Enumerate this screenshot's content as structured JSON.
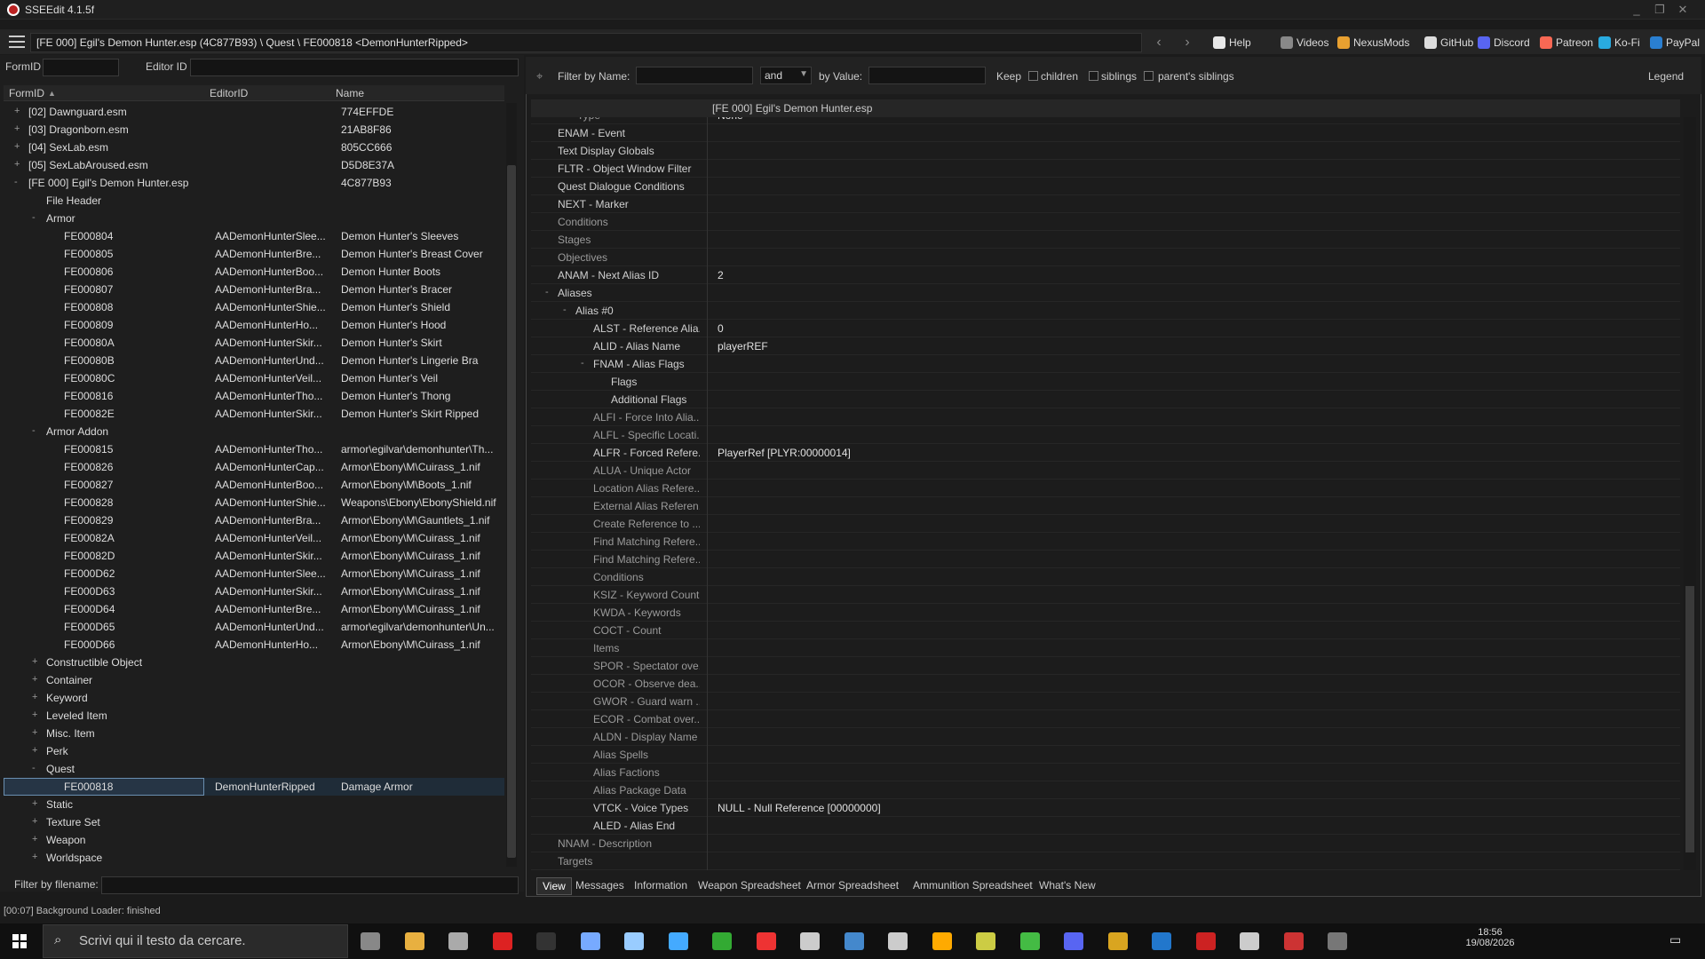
{
  "window": {
    "title": "SSEEdit 4.1.5f"
  },
  "path": "[FE 000] Egil's Demon Hunter.esp (4C877B93) \\ Quest \\ FE000818 <DemonHunterRipped>",
  "toplinks": [
    {
      "label": "Help",
      "icon": "book-icon",
      "color": "#e8e8e8"
    },
    {
      "label": "Videos",
      "icon": "videos-icon",
      "color": "#888888"
    },
    {
      "label": "NexusMods",
      "icon": "nexusmods-icon",
      "color": "#e8a030"
    },
    {
      "label": "GitHub",
      "icon": "github-icon",
      "color": "#dddddd"
    },
    {
      "label": "Discord",
      "icon": "discord-icon",
      "color": "#5865f2"
    },
    {
      "label": "Patreon",
      "icon": "patreon-icon",
      "color": "#f96854"
    },
    {
      "label": "Ko-Fi",
      "icon": "kofi-icon",
      "color": "#29abe0"
    },
    {
      "label": "PayPal",
      "icon": "paypal-icon",
      "color": "#2a7fd0"
    }
  ],
  "left": {
    "formid_label": "FormID",
    "editorid_label": "Editor ID",
    "columns": [
      "FormID",
      "EditorID",
      "Name"
    ],
    "filter_label": "Filter by filename:",
    "rows": [
      {
        "indent": 1,
        "exp": "+",
        "c1": "[02] Dawnguard.esm",
        "c2": "",
        "c3": "774EFFDE"
      },
      {
        "indent": 1,
        "exp": "+",
        "c1": "[03] Dragonborn.esm",
        "c2": "",
        "c3": "21AB8F86"
      },
      {
        "indent": 1,
        "exp": "+",
        "c1": "[04] SexLab.esm",
        "c2": "",
        "c3": "805CC666"
      },
      {
        "indent": 1,
        "exp": "+",
        "c1": "[05] SexLabAroused.esm",
        "c2": "",
        "c3": "D5D8E37A"
      },
      {
        "indent": 1,
        "exp": "-",
        "c1": "[FE 000] Egil's Demon Hunter.esp",
        "c2": "",
        "c3": "4C877B93"
      },
      {
        "indent": 2,
        "exp": "",
        "c1": "File Header",
        "c2": "",
        "c3": ""
      },
      {
        "indent": 2,
        "exp": "-",
        "c1": "Armor",
        "c2": "",
        "c3": ""
      },
      {
        "indent": 3,
        "exp": "",
        "c1": "FE000804",
        "c2": "AADemonHunterSlee...",
        "c3": "Demon Hunter's Sleeves"
      },
      {
        "indent": 3,
        "exp": "",
        "c1": "FE000805",
        "c2": "AADemonHunterBre...",
        "c3": "Demon Hunter's Breast Cover"
      },
      {
        "indent": 3,
        "exp": "",
        "c1": "FE000806",
        "c2": "AADemonHunterBoo...",
        "c3": "Demon Hunter Boots"
      },
      {
        "indent": 3,
        "exp": "",
        "c1": "FE000807",
        "c2": "AADemonHunterBra...",
        "c3": "Demon Hunter's Bracer"
      },
      {
        "indent": 3,
        "exp": "",
        "c1": "FE000808",
        "c2": "AADemonHunterShie...",
        "c3": "Demon Hunter's Shield"
      },
      {
        "indent": 3,
        "exp": "",
        "c1": "FE000809",
        "c2": "AADemonHunterHo...",
        "c3": "Demon Hunter's Hood"
      },
      {
        "indent": 3,
        "exp": "",
        "c1": "FE00080A",
        "c2": "AADemonHunterSkir...",
        "c3": "Demon Hunter's Skirt"
      },
      {
        "indent": 3,
        "exp": "",
        "c1": "FE00080B",
        "c2": "AADemonHunterUnd...",
        "c3": "Demon Hunter's Lingerie Bra"
      },
      {
        "indent": 3,
        "exp": "",
        "c1": "FE00080C",
        "c2": "AADemonHunterVeil...",
        "c3": "Demon Hunter's Veil"
      },
      {
        "indent": 3,
        "exp": "",
        "c1": "FE000816",
        "c2": "AADemonHunterTho...",
        "c3": "Demon Hunter's Thong"
      },
      {
        "indent": 3,
        "exp": "",
        "c1": "FE00082E",
        "c2": "AADemonHunterSkir...",
        "c3": "Demon Hunter's Skirt Ripped"
      },
      {
        "indent": 2,
        "exp": "-",
        "c1": "Armor Addon",
        "c2": "",
        "c3": ""
      },
      {
        "indent": 3,
        "exp": "",
        "c1": "FE000815",
        "c2": "AADemonHunterTho...",
        "c3": "armor\\egilvar\\demonhunter\\Th..."
      },
      {
        "indent": 3,
        "exp": "",
        "c1": "FE000826",
        "c2": "AADemonHunterCap...",
        "c3": "Armor\\Ebony\\M\\Cuirass_1.nif"
      },
      {
        "indent": 3,
        "exp": "",
        "c1": "FE000827",
        "c2": "AADemonHunterBoo...",
        "c3": "Armor\\Ebony\\M\\Boots_1.nif"
      },
      {
        "indent": 3,
        "exp": "",
        "c1": "FE000828",
        "c2": "AADemonHunterShie...",
        "c3": "Weapons\\Ebony\\EbonyShield.nif"
      },
      {
        "indent": 3,
        "exp": "",
        "c1": "FE000829",
        "c2": "AADemonHunterBra...",
        "c3": "Armor\\Ebony\\M\\Gauntlets_1.nif"
      },
      {
        "indent": 3,
        "exp": "",
        "c1": "FE00082A",
        "c2": "AADemonHunterVeil...",
        "c3": "Armor\\Ebony\\M\\Cuirass_1.nif"
      },
      {
        "indent": 3,
        "exp": "",
        "c1": "FE00082D",
        "c2": "AADemonHunterSkir...",
        "c3": "Armor\\Ebony\\M\\Cuirass_1.nif"
      },
      {
        "indent": 3,
        "exp": "",
        "c1": "FE000D62",
        "c2": "AADemonHunterSlee...",
        "c3": "Armor\\Ebony\\M\\Cuirass_1.nif"
      },
      {
        "indent": 3,
        "exp": "",
        "c1": "FE000D63",
        "c2": "AADemonHunterSkir...",
        "c3": "Armor\\Ebony\\M\\Cuirass_1.nif"
      },
      {
        "indent": 3,
        "exp": "",
        "c1": "FE000D64",
        "c2": "AADemonHunterBre...",
        "c3": "Armor\\Ebony\\M\\Cuirass_1.nif"
      },
      {
        "indent": 3,
        "exp": "",
        "c1": "FE000D65",
        "c2": "AADemonHunterUnd...",
        "c3": "armor\\egilvar\\demonhunter\\Un..."
      },
      {
        "indent": 3,
        "exp": "",
        "c1": "FE000D66",
        "c2": "AADemonHunterHo...",
        "c3": "Armor\\Ebony\\M\\Cuirass_1.nif"
      },
      {
        "indent": 2,
        "exp": "+",
        "c1": "Constructible Object",
        "c2": "",
        "c3": ""
      },
      {
        "indent": 2,
        "exp": "+",
        "c1": "Container",
        "c2": "",
        "c3": ""
      },
      {
        "indent": 2,
        "exp": "+",
        "c1": "Keyword",
        "c2": "",
        "c3": ""
      },
      {
        "indent": 2,
        "exp": "+",
        "c1": "Leveled Item",
        "c2": "",
        "c3": ""
      },
      {
        "indent": 2,
        "exp": "+",
        "c1": "Misc. Item",
        "c2": "",
        "c3": ""
      },
      {
        "indent": 2,
        "exp": "+",
        "c1": "Perk",
        "c2": "",
        "c3": ""
      },
      {
        "indent": 2,
        "exp": "-",
        "c1": "Quest",
        "c2": "",
        "c3": ""
      },
      {
        "indent": 3,
        "exp": "",
        "c1": "FE000818",
        "c2": "DemonHunterRipped",
        "c3": "Damage Armor",
        "selected": true
      },
      {
        "indent": 2,
        "exp": "+",
        "c1": "Static",
        "c2": "",
        "c3": ""
      },
      {
        "indent": 2,
        "exp": "+",
        "c1": "Texture Set",
        "c2": "",
        "c3": ""
      },
      {
        "indent": 2,
        "exp": "+",
        "c1": "Weapon",
        "c2": "",
        "c3": ""
      },
      {
        "indent": 2,
        "exp": "+",
        "c1": "Worldspace",
        "c2": "",
        "c3": ""
      }
    ]
  },
  "right": {
    "filter_name_label": "Filter by Name:",
    "and_value": "and",
    "by_value_label": "by Value:",
    "keep_label": "Keep",
    "children_label": "children",
    "siblings_label": "siblings",
    "parents_label": "parent's siblings",
    "legend": "Legend",
    "header": "[FE 000] Egil's Demon Hunter.esp",
    "partial_top": "Type",
    "partial_top_value": "None",
    "rows": [
      {
        "lvl": 0,
        "label": "ENAM - Event",
        "value": ""
      },
      {
        "lvl": 0,
        "label": "Text Display Globals",
        "value": ""
      },
      {
        "lvl": 0,
        "label": "FLTR - Object Window Filter",
        "value": ""
      },
      {
        "lvl": 0,
        "label": "Quest Dialogue Conditions",
        "value": ""
      },
      {
        "lvl": 0,
        "label": "NEXT - Marker",
        "value": ""
      },
      {
        "lvl": 0,
        "label": "Conditions",
        "value": "",
        "dim": true
      },
      {
        "lvl": 0,
        "label": "Stages",
        "value": "",
        "dim": true
      },
      {
        "lvl": 0,
        "label": "Objectives",
        "value": "",
        "dim": true
      },
      {
        "lvl": 0,
        "label": "ANAM - Next Alias ID",
        "value": "2"
      },
      {
        "lvl": 0,
        "label": "Aliases",
        "value": "",
        "exp": "-"
      },
      {
        "lvl": 1,
        "label": "Alias #0",
        "value": "",
        "exp": "-"
      },
      {
        "lvl": 2,
        "label": "ALST - Reference Alia...",
        "value": "0"
      },
      {
        "lvl": 2,
        "label": "ALID - Alias Name",
        "value": "playerREF"
      },
      {
        "lvl": 2,
        "label": "FNAM - Alias Flags",
        "value": "",
        "exp": "-"
      },
      {
        "lvl": 3,
        "label": "Flags",
        "value": ""
      },
      {
        "lvl": 3,
        "label": "Additional Flags",
        "value": ""
      },
      {
        "lvl": 2,
        "label": "ALFI - Force Into Alia...",
        "value": "",
        "dim": true
      },
      {
        "lvl": 2,
        "label": "ALFL - Specific Locati...",
        "value": "",
        "dim": true
      },
      {
        "lvl": 2,
        "label": "ALFR - Forced Refere...",
        "value": "PlayerRef [PLYR:00000014]"
      },
      {
        "lvl": 2,
        "label": "ALUA - Unique Actor",
        "value": "",
        "dim": true
      },
      {
        "lvl": 2,
        "label": "Location Alias Refere...",
        "value": "",
        "dim": true
      },
      {
        "lvl": 2,
        "label": "External Alias Referen...",
        "value": "",
        "dim": true
      },
      {
        "lvl": 2,
        "label": "Create Reference to ...",
        "value": "",
        "dim": true
      },
      {
        "lvl": 2,
        "label": "Find Matching Refere...",
        "value": "",
        "dim": true
      },
      {
        "lvl": 2,
        "label": "Find Matching Refere...",
        "value": "",
        "dim": true
      },
      {
        "lvl": 2,
        "label": "Conditions",
        "value": "",
        "dim": true
      },
      {
        "lvl": 2,
        "label": "KSIZ - Keyword Count",
        "value": "",
        "dim": true
      },
      {
        "lvl": 2,
        "label": "KWDA - Keywords",
        "value": "",
        "dim": true
      },
      {
        "lvl": 2,
        "label": "COCT - Count",
        "value": "",
        "dim": true
      },
      {
        "lvl": 2,
        "label": "Items",
        "value": "",
        "dim": true
      },
      {
        "lvl": 2,
        "label": "SPOR - Spectator ove...",
        "value": "",
        "dim": true
      },
      {
        "lvl": 2,
        "label": "OCOR - Observe dea...",
        "value": "",
        "dim": true
      },
      {
        "lvl": 2,
        "label": "GWOR - Guard warn ...",
        "value": "",
        "dim": true
      },
      {
        "lvl": 2,
        "label": "ECOR - Combat over...",
        "value": "",
        "dim": true
      },
      {
        "lvl": 2,
        "label": "ALDN - Display Name",
        "value": "",
        "dim": true
      },
      {
        "lvl": 2,
        "label": "Alias Spells",
        "value": "",
        "dim": true
      },
      {
        "lvl": 2,
        "label": "Alias Factions",
        "value": "",
        "dim": true
      },
      {
        "lvl": 2,
        "label": "Alias Package Data",
        "value": "",
        "dim": true
      },
      {
        "lvl": 2,
        "label": "VTCK - Voice Types",
        "value": "NULL - Null Reference [00000000]"
      },
      {
        "lvl": 2,
        "label": "ALED - Alias End",
        "value": ""
      },
      {
        "lvl": 0,
        "label": "NNAM - Description",
        "value": "",
        "dim": true
      },
      {
        "lvl": 0,
        "label": "Targets",
        "value": "",
        "dim": true
      }
    ],
    "tabs": [
      "View",
      "Messages",
      "Information",
      "Weapon Spreadsheet",
      "Armor Spreadsheet",
      "Ammunition Spreadsheet",
      "What's New"
    ]
  },
  "status": "[00:07] Background Loader: finished",
  "taskbar": {
    "search_placeholder": "Scrivi qui il testo da cercare.",
    "time": "18:56",
    "date": "19/08/2026"
  }
}
